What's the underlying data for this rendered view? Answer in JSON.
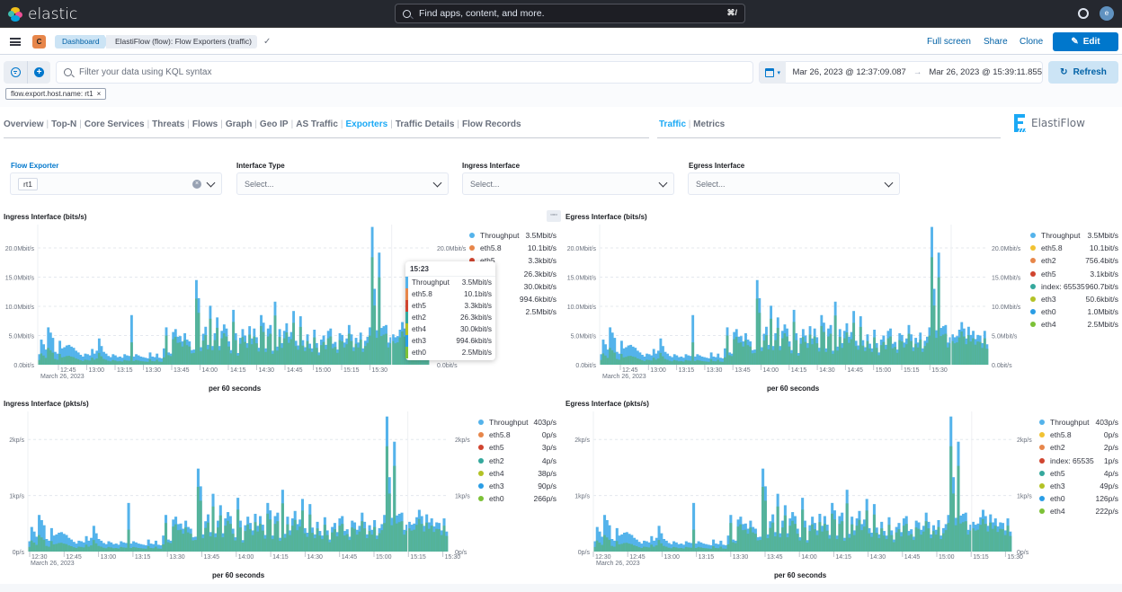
{
  "topbar": {
    "brand": "elastic",
    "search_placeholder": "Find apps, content, and more.",
    "search_shortcut": "⌘/",
    "avatar_initial": "e"
  },
  "header": {
    "space_initial": "C",
    "breadcrumbs": [
      "Dashboard",
      "ElastiFlow (flow): Flow Exporters (traffic)"
    ],
    "actions": {
      "full_screen": "Full screen",
      "share": "Share",
      "clone": "Clone",
      "edit": "Edit"
    }
  },
  "query": {
    "placeholder": "Filter your data using KQL syntax",
    "date_start": "Mar 26, 2023 @ 12:37:09.087",
    "date_arrow": "→",
    "date_end": "Mar 26, 2023 @ 15:39:11.855",
    "refresh": "Refresh",
    "filter_pill": "flow.export.host.name: rt1",
    "filter_pill_close": "×"
  },
  "nav": {
    "links": [
      "Overview",
      "Top-N",
      "Core Services",
      "Threats",
      "Flows",
      "Graph",
      "Geo IP",
      "AS Traffic",
      "Exporters",
      "Traffic Details",
      "Flow Records"
    ],
    "active": "Exporters",
    "sublinks": [
      "Traffic",
      "Metrics"
    ],
    "sub_active": "Traffic",
    "logo_text": "ElastiFlow"
  },
  "controls": [
    {
      "label": "Flow Exporter",
      "value": "rt1",
      "placeholder": ""
    },
    {
      "label": "Interface Type",
      "value": "",
      "placeholder": "Select..."
    },
    {
      "label": "Ingress Interface",
      "value": "",
      "placeholder": "Select..."
    },
    {
      "label": "Egress Interface",
      "value": "",
      "placeholder": "Select..."
    }
  ],
  "colors": {
    "throughput": "#54b3eb",
    "fill_green": "#54b399",
    "accent": "#0077cc",
    "nav_active": "#1ba9f5"
  },
  "tooltip": {
    "time": "15:23",
    "rows": [
      {
        "label": "Throughput",
        "value": "3.5Mbit/s",
        "color": "#54b3eb"
      },
      {
        "label": "eth5.8",
        "value": "10.1bit/s",
        "color": "#e7864a"
      },
      {
        "label": "eth5",
        "value": "3.3kbit/s",
        "color": "#d0442f"
      },
      {
        "label": "eth2",
        "value": "26.3kbit/s",
        "color": "#35a89d"
      },
      {
        "label": "eth4",
        "value": "30.0kbit/s",
        "color": "#b3c226"
      },
      {
        "label": "eth3",
        "value": "994.6kbit/s",
        "color": "#2a9de5"
      },
      {
        "label": "eth0",
        "value": "2.5Mbit/s",
        "color": "#7cc137"
      }
    ]
  },
  "chart_data": [
    {
      "type": "area",
      "title": "Ingress Interface (bits/s)",
      "xlabel": "per 60 seconds",
      "x_ticks": [
        "12:45",
        "13:00",
        "13:15",
        "13:30",
        "13:45",
        "14:00",
        "14:15",
        "14:30",
        "14:45",
        "15:00",
        "15:15",
        "15:30"
      ],
      "x_sub": "March 26, 2023",
      "y_ticks": [
        "0.0bit/s",
        "5.0Mbit/s",
        "10.0Mbit/s",
        "15.0Mbit/s",
        "20.0Mbit/s"
      ],
      "ylim": [
        0,
        24
      ],
      "yunit": "Mbit/s",
      "legend": [
        {
          "name": "Throughput",
          "value": "3.5Mbit/s",
          "color": "#54b3eb"
        },
        {
          "name": "eth5.8",
          "value": "10.1bit/s",
          "color": "#e7864a"
        },
        {
          "name": "eth5",
          "value": "3.3kbit/s",
          "color": "#d0442f"
        },
        {
          "name": "eth2",
          "value": "26.3kbit/s",
          "color": "#35a89d"
        },
        {
          "name": "eth4",
          "value": "30.0kbit/s",
          "color": "#b3c226"
        },
        {
          "name": "eth3",
          "value": "994.6kbit/s",
          "color": "#2a9de5"
        },
        {
          "name": "eth0",
          "value": "2.5Mbit/s",
          "color": "#7cc137"
        }
      ],
      "shape": [
        1.8,
        4.3,
        3.5,
        2.6,
        6.4,
        5.5,
        4.6,
        2.2,
        1.9,
        4.1,
        2.8,
        3.0,
        3.3,
        3.4,
        3.1,
        2.9,
        2.4,
        2.1,
        1.7,
        1.4,
        1.9,
        1.8,
        1.6,
        2.7,
        1.9,
        2.4,
        4.5,
        3.2,
        2.2,
        1.9,
        1.5,
        1.3,
        1.8,
        1.6,
        1.3,
        1.4,
        1.2,
        1.8,
        1.6,
        1.5,
        8.5,
        1.4,
        1.8,
        1.6,
        1.4,
        1.3,
        1.2,
        1.1,
        2.1,
        1.4,
        1.3,
        1.9,
        1.2,
        1.1,
        2.8,
        6.4,
        2.1,
        1.9,
        5.6,
        6.1,
        4.8,
        4.9,
        4.0,
        5.4,
        4.3,
        4.0,
        2.5,
        2.6,
        14.5,
        11.4,
        3.0,
        5.3,
        6.5,
        3.4,
        10.1,
        3.2,
        5.4,
        8.1,
        3.2,
        5.8,
        6.9,
        6.2,
        4.0,
        2.5,
        9.4,
        5.4,
        2.0,
        4.6,
        6.1,
        5.0,
        3.7,
        6.6,
        4.5,
        6.2,
        4.7,
        2.9,
        8.5,
        7.2,
        2.8,
        6.2,
        6.8,
        2.4,
        10.8,
        3.1,
        6.1,
        3.7,
        5.8,
        7.1,
        4.8,
        5.6,
        9.2,
        4.1,
        3.3,
        8.3,
        4.2,
        3.0,
        5.2,
        3.6,
        2.8,
        6.0,
        3.7,
        2.1,
        4.3,
        5.0,
        3.4,
        5.8,
        6.2,
        3.6,
        3.9,
        2.6,
        5.4,
        5.1,
        3.8,
        4.5,
        6.8,
        5.2,
        3.0,
        4.6,
        3.8,
        5.5,
        2.8,
        4.1,
        4.8,
        6.4,
        23.6,
        13.0,
        5.9,
        19.2,
        6.3,
        6.6,
        6.8,
        3.8,
        4.7,
        5.2,
        4.7,
        4.9,
        6.0,
        7.3,
        6.2,
        4.5,
        6.5,
        5.1,
        5.8,
        4.4,
        5.1,
        5.0,
        3.7,
        5.8,
        3.5
      ]
    },
    {
      "type": "area",
      "title": "Egress Interface (bits/s)",
      "xlabel": "per 60 seconds",
      "x_ticks": [
        "12:45",
        "13:00",
        "13:15",
        "13:30",
        "13:45",
        "14:00",
        "14:15",
        "14:30",
        "14:45",
        "15:00",
        "15:15",
        "15:30"
      ],
      "x_sub": "March 26, 2023",
      "y_ticks": [
        "0.0bit/s",
        "5.0Mbit/s",
        "10.0Mbit/s",
        "15.0Mbit/s",
        "20.0Mbit/s"
      ],
      "ylim": [
        0,
        24
      ],
      "yunit": "Mbit/s",
      "legend": [
        {
          "name": "Throughput",
          "value": "3.5Mbit/s",
          "color": "#54b3eb"
        },
        {
          "name": "eth5.8",
          "value": "10.1bit/s",
          "color": "#f1c232"
        },
        {
          "name": "eth2",
          "value": "756.4bit/s",
          "color": "#e7864a"
        },
        {
          "name": "eth5",
          "value": "3.1kbit/s",
          "color": "#d0442f"
        },
        {
          "name": "index: 65535",
          "value": "960.7bit/s",
          "color": "#35a89d"
        },
        {
          "name": "eth3",
          "value": "50.6kbit/s",
          "color": "#b3c226"
        },
        {
          "name": "eth0",
          "value": "1.0Mbit/s",
          "color": "#2a9de5"
        },
        {
          "name": "eth4",
          "value": "2.5Mbit/s",
          "color": "#7cc137"
        }
      ]
    },
    {
      "type": "area",
      "title": "Ingress Interface (pkts/s)",
      "xlabel": "per 60 seconds",
      "x_ticks": [
        "12:30",
        "12:45",
        "13:00",
        "13:15",
        "13:30",
        "13:45",
        "14:00",
        "14:15",
        "14:30",
        "14:45",
        "15:00",
        "15:15",
        "15:30"
      ],
      "x_sub": "March 26, 2023",
      "y_ticks": [
        "0p/s",
        "1kp/s",
        "2kp/s"
      ],
      "ylim": [
        0,
        2.5
      ],
      "yunit": "kp/s",
      "legend": [
        {
          "name": "Throughput",
          "value": "403p/s",
          "color": "#54b3eb"
        },
        {
          "name": "eth5.8",
          "value": "0p/s",
          "color": "#e7864a"
        },
        {
          "name": "eth5",
          "value": "3p/s",
          "color": "#d0442f"
        },
        {
          "name": "eth2",
          "value": "4p/s",
          "color": "#35a89d"
        },
        {
          "name": "eth4",
          "value": "38p/s",
          "color": "#b3c226"
        },
        {
          "name": "eth3",
          "value": "90p/s",
          "color": "#2a9de5"
        },
        {
          "name": "eth0",
          "value": "266p/s",
          "color": "#7cc137"
        }
      ]
    },
    {
      "type": "area",
      "title": "Egress Interface (pkts/s)",
      "xlabel": "per 60 seconds",
      "x_ticks": [
        "12:30",
        "12:45",
        "13:00",
        "13:15",
        "13:30",
        "13:45",
        "14:00",
        "14:15",
        "14:30",
        "14:45",
        "15:00",
        "15:15",
        "15:30"
      ],
      "x_sub": "March 26, 2023",
      "y_ticks": [
        "0p/s",
        "1kp/s",
        "2kp/s"
      ],
      "ylim": [
        0,
        2.5
      ],
      "yunit": "kp/s",
      "legend": [
        {
          "name": "Throughput",
          "value": "403p/s",
          "color": "#54b3eb"
        },
        {
          "name": "eth5.8",
          "value": "0p/s",
          "color": "#f1c232"
        },
        {
          "name": "eth2",
          "value": "2p/s",
          "color": "#e7864a"
        },
        {
          "name": "index: 65535",
          "value": "1p/s",
          "color": "#d0442f"
        },
        {
          "name": "eth5",
          "value": "4p/s",
          "color": "#35a89d"
        },
        {
          "name": "eth3",
          "value": "49p/s",
          "color": "#b3c226"
        },
        {
          "name": "eth0",
          "value": "126p/s",
          "color": "#2a9de5"
        },
        {
          "name": "eth4",
          "value": "222p/s",
          "color": "#7cc137"
        }
      ]
    }
  ]
}
